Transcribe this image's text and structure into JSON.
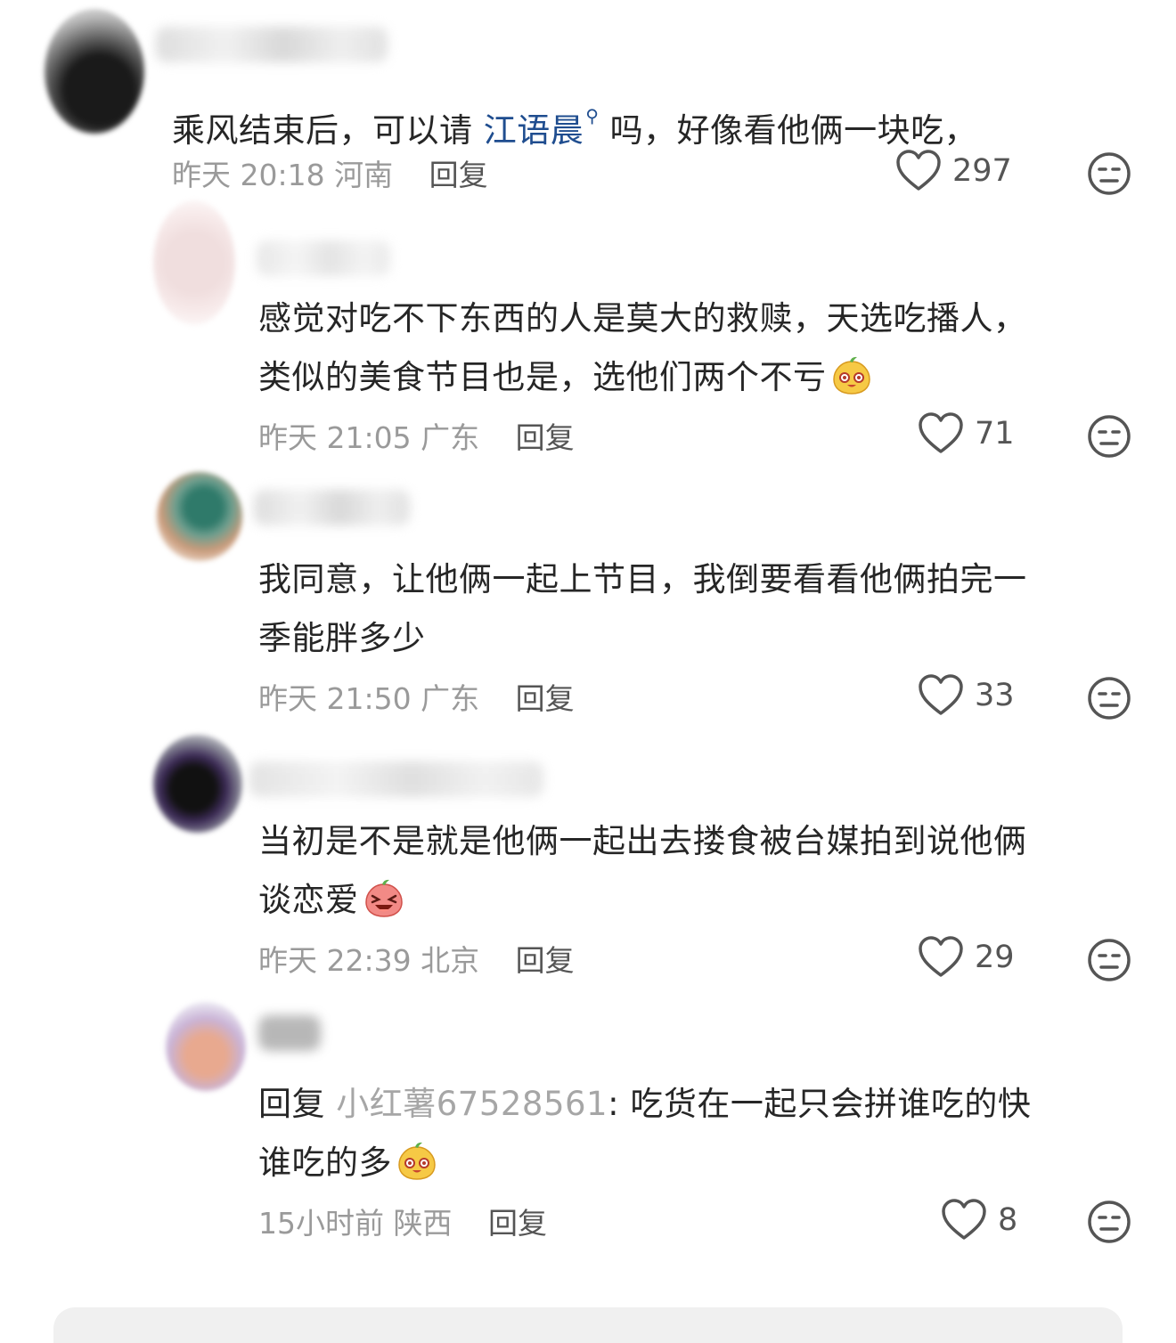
{
  "comments": [
    {
      "text_before": "乘风结束后，可以请 ",
      "mention": "江语晨",
      "text_after": " 吗，好像看他俩一块吃，",
      "time": "昨天 20:18",
      "location": "河南",
      "reply_label": "回复",
      "likes": "297"
    },
    {
      "line1": "感觉对吃不下东西的人是莫大的救赎，天选吃播人，",
      "line2": "类似的美食节目也是，选他们两个不亏",
      "emoji": "smile-sticker",
      "time": "昨天 21:05",
      "location": "广东",
      "reply_label": "回复",
      "likes": "71"
    },
    {
      "line1": "我同意，让他俩一起上节目，我倒要看看他俩拍完一",
      "line2": "季能胖多少",
      "time": "昨天 21:50",
      "location": "广东",
      "reply_label": "回复",
      "likes": "33"
    },
    {
      "line1": "当初是不是就是他俩一起出去搂食被台媒拍到说他俩",
      "line2": "谈恋爱",
      "emoji": "laugh-sticker",
      "time": "昨天 22:39",
      "location": "北京",
      "reply_label": "回复",
      "likes": "29"
    },
    {
      "reply_prefix": "回复 ",
      "reply_to": "小红薯67528561",
      "line1_rest": ": 吃货在一起只会拼谁吃的快",
      "line2": "谁吃的多",
      "emoji": "smile-sticker",
      "time": "15小时前",
      "location": "陕西",
      "reply_label": "回复",
      "likes": "8"
    }
  ],
  "colors": {
    "mention": "#1f4d8f",
    "meta": "#9a9a9a",
    "text": "#262626"
  }
}
